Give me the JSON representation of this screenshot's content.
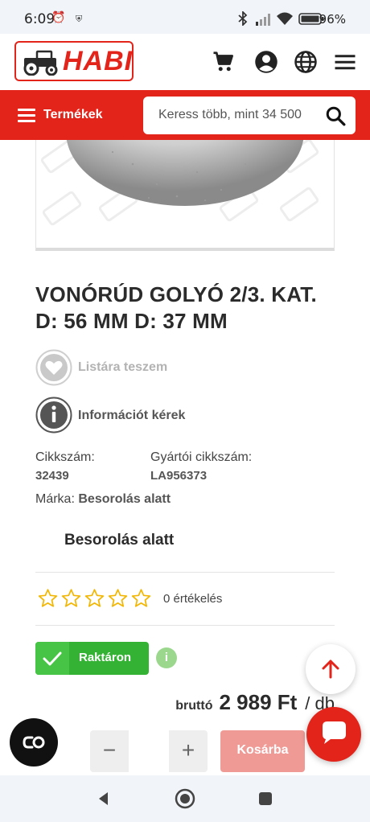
{
  "status_bar": {
    "time": "6:09",
    "battery": "96%",
    "icons": [
      "alarm-off-icon",
      "shield-icon",
      "bluetooth-icon",
      "signal-icon",
      "wifi-icon",
      "battery-icon"
    ]
  },
  "header": {
    "logo_text": "HABI",
    "icons": [
      "cart-icon",
      "account-icon",
      "globe-icon",
      "hamburger-menu-icon"
    ]
  },
  "nav": {
    "menu_label": "Termékek",
    "search_placeholder": "Keress több, mint 34 500"
  },
  "product": {
    "title_line1": "VONÓRÚD GOLYÓ 2/3. KAT.",
    "title_line2": "D: 56 MM D: 37 MM",
    "wishlist_label": "Listára teszem",
    "info_label": "Információt kérek",
    "sku_label": "Cikkszám:",
    "sku_value": "32439",
    "mfr_label": "Gyártói cikkszám:",
    "mfr_value": "LA956373",
    "brand_label": "Márka:",
    "brand_value": "Besorolás alatt",
    "brand_block": "Besorolás alatt",
    "rating": 0,
    "rating_max": 5,
    "reviews_text": "0 értékelés",
    "stock_label": "Raktáron",
    "info_dot": "i",
    "price_label": "bruttó",
    "price_value": "2 989 Ft",
    "price_unit": "/ db",
    "qty_minus": "−",
    "qty_plus": "+",
    "qty_value": "",
    "cart_label": "Kosárba"
  },
  "colors": {
    "brand_red": "#e3241b",
    "stock_green": "#34b233",
    "star_yellow": "#f2b705"
  }
}
